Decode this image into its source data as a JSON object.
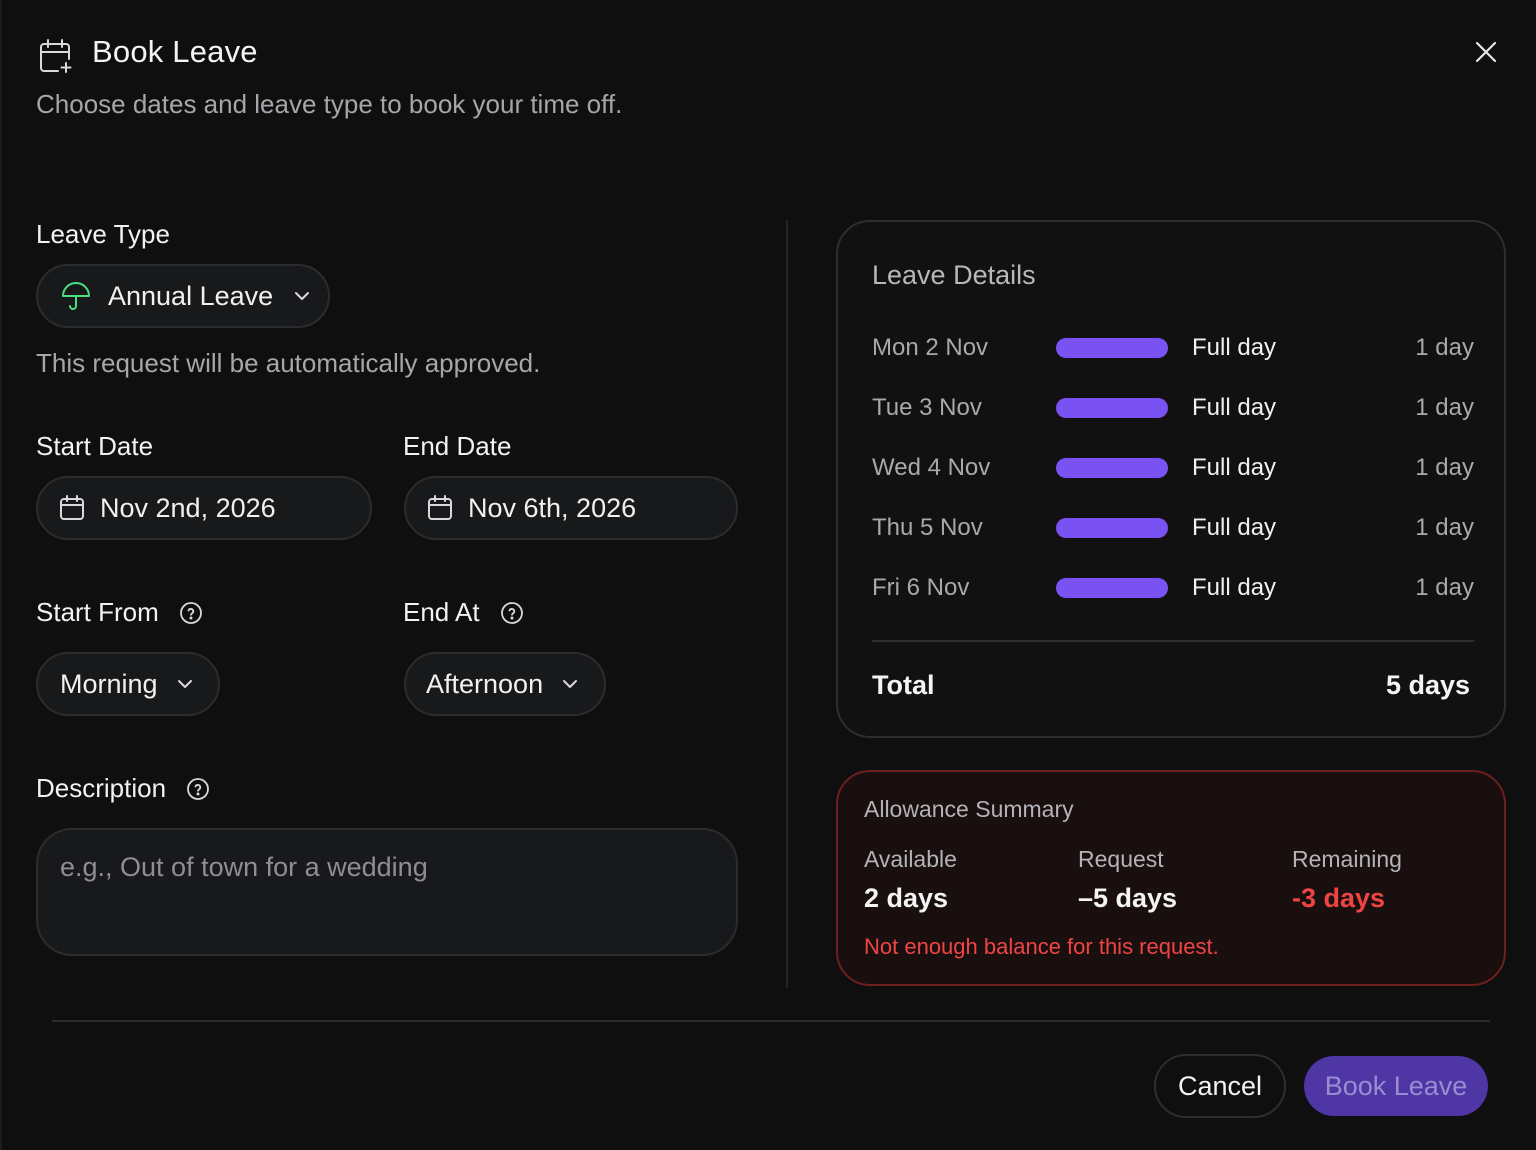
{
  "dialog": {
    "title": "Book Leave",
    "subtitle": "Choose dates and leave type to book your time off.",
    "header_icon": "calendar-plus-icon",
    "close_icon": "close-icon"
  },
  "form": {
    "leave_type": {
      "label": "Leave Type",
      "value": "Annual Leave",
      "icon": "umbrella-icon",
      "note": "This request will be automatically approved."
    },
    "start_date": {
      "label": "Start Date",
      "value": "Nov 2nd, 2026"
    },
    "end_date": {
      "label": "End Date",
      "value": "Nov 6th, 2026"
    },
    "start_from": {
      "label": "Start From",
      "value": "Morning"
    },
    "end_at": {
      "label": "End At",
      "value": "Afternoon"
    },
    "description": {
      "label": "Description",
      "placeholder": "e.g., Out of town for a wedding"
    }
  },
  "details": {
    "title": "Leave Details",
    "days": [
      {
        "date": "Mon 2 Nov",
        "type": "Full day",
        "count": "1 day"
      },
      {
        "date": "Tue 3 Nov",
        "type": "Full day",
        "count": "1 day"
      },
      {
        "date": "Wed 4 Nov",
        "type": "Full day",
        "count": "1 day"
      },
      {
        "date": "Thu 5 Nov",
        "type": "Full day",
        "count": "1 day"
      },
      {
        "date": "Fri 6 Nov",
        "type": "Full day",
        "count": "1 day"
      }
    ],
    "total_label": "Total",
    "total_value": "5 days"
  },
  "allowance": {
    "title": "Allowance Summary",
    "available_label": "Available",
    "available_value": "2 days",
    "request_label": "Request",
    "request_value": "–5 days",
    "remaining_label": "Remaining",
    "remaining_value": "-3 days",
    "warning": "Not enough balance for this request."
  },
  "actions": {
    "cancel": "Cancel",
    "book": "Book Leave"
  },
  "colors": {
    "accent": "#7a52f4",
    "umbrella": "#4ade80",
    "error": "#ef4444",
    "book_button": "#4f36a5"
  }
}
